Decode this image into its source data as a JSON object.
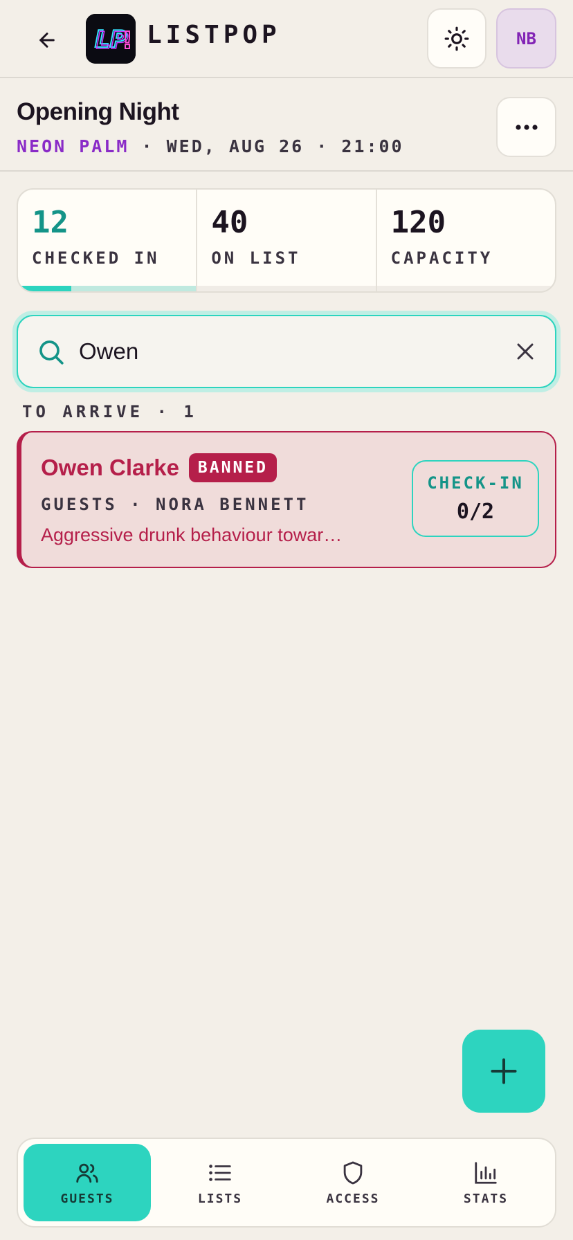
{
  "header": {
    "brand": "LISTPOP",
    "avatar_initials": "NB"
  },
  "event": {
    "title": "Opening Night",
    "venue": "NEON PALM",
    "date_time": "· WED, AUG 26 · 21:00"
  },
  "stats": [
    {
      "value": "12",
      "label": "CHECKED IN",
      "progress": 0.3
    },
    {
      "value": "40",
      "label": "ON LIST"
    },
    {
      "value": "120",
      "label": "CAPACITY"
    }
  ],
  "search": {
    "value": "Owen"
  },
  "section": {
    "label": "TO ARRIVE · 1"
  },
  "guest": {
    "name": "Owen Clarke",
    "badge": "BANNED",
    "meta": "GUESTS · NORA BENNETT",
    "note": "Aggressive drunk behaviour towards staff",
    "checkin_label": "CHECK-IN",
    "checkin_count": "0/2"
  },
  "nav": {
    "items": [
      {
        "label": "GUESTS",
        "icon": "users-icon",
        "active": true
      },
      {
        "label": "LISTS",
        "icon": "list-icon"
      },
      {
        "label": "ACCESS",
        "icon": "shield-icon"
      },
      {
        "label": "STATS",
        "icon": "bar-chart-icon"
      }
    ]
  },
  "colors": {
    "accent": "#2dd4bf",
    "accent_text": "#149488",
    "banned": "#b51f4a",
    "venue": "#8a2bc7",
    "background": "#f3efe8"
  }
}
